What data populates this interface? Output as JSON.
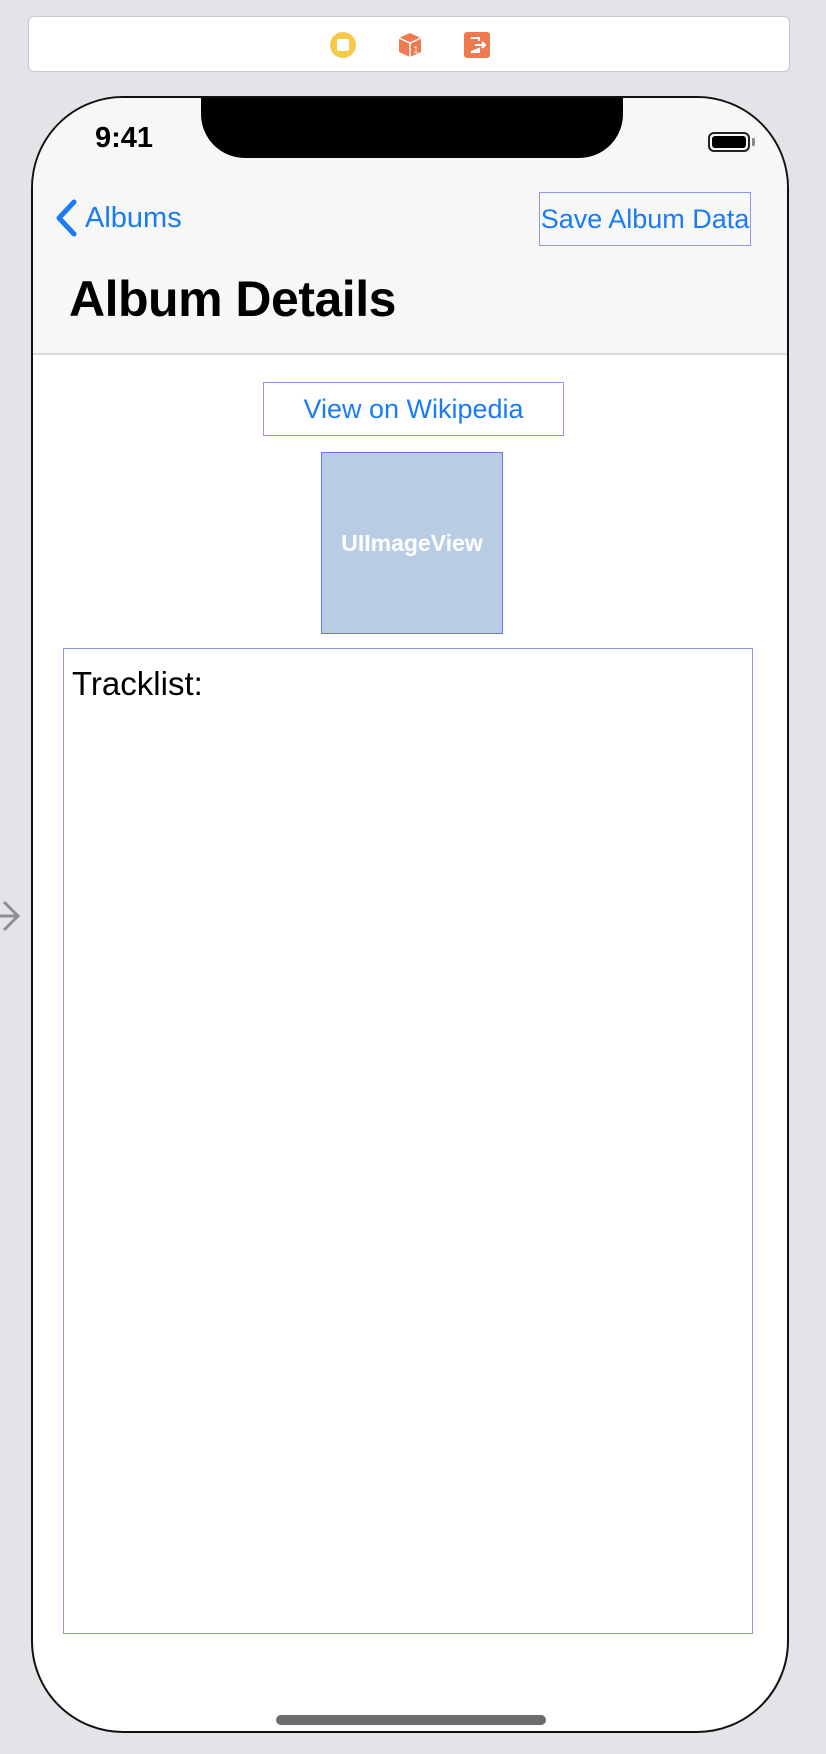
{
  "scene_bar": {
    "icons": [
      "view-controller-icon",
      "first-responder-icon",
      "exit-icon"
    ],
    "colors": {
      "view_controller": "#f7c948",
      "first_responder": "#f07a4f",
      "exit": "#f07a4f"
    }
  },
  "status_bar": {
    "time": "9:41"
  },
  "nav": {
    "back_label": "Albums",
    "right_button_label": "Save Album Data",
    "title": "Album Details"
  },
  "content": {
    "wiki_button_label": "View on Wikipedia",
    "image_view_label": "UIImageView",
    "tracklist_text": "Tracklist:"
  },
  "colors": {
    "tint": "#1a7cf5",
    "selection_outline": "#8f96f0",
    "image_placeholder": "#b8cce4"
  }
}
